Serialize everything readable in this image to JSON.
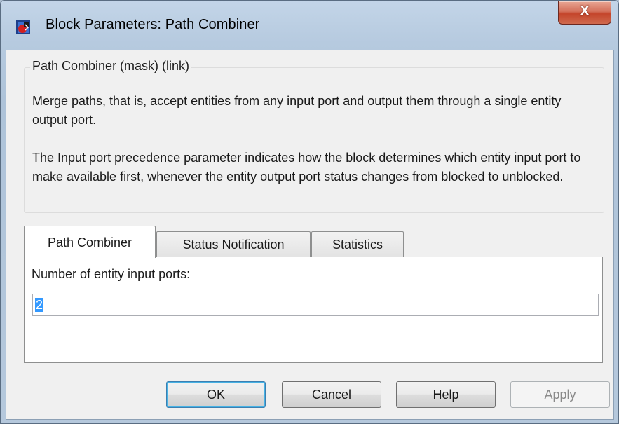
{
  "window": {
    "title": "Block Parameters: Path Combiner",
    "close_glyph": "X"
  },
  "group": {
    "legend": "Path Combiner (mask) (link)",
    "paragraph1": "Merge paths, that is, accept entities from any input port and output them through a single entity output port.",
    "paragraph2": "The Input port precedence parameter indicates how the block determines which entity input port to make available first, whenever the entity output port status changes from blocked to unblocked."
  },
  "tabs": [
    {
      "label": "Path Combiner",
      "active": true
    },
    {
      "label": "Status Notification",
      "active": false
    },
    {
      "label": "Statistics",
      "active": false
    }
  ],
  "panel": {
    "field_label": "Number of entity input ports:",
    "field_value": "2"
  },
  "buttons": {
    "ok": "OK",
    "cancel": "Cancel",
    "help": "Help",
    "apply": "Apply"
  },
  "icons": {
    "app": "simulink-block-icon",
    "close": "close-icon"
  },
  "colors": {
    "close_button": "#c4452b",
    "selection": "#3399ff",
    "default_button_border": "#3c7fb1"
  }
}
